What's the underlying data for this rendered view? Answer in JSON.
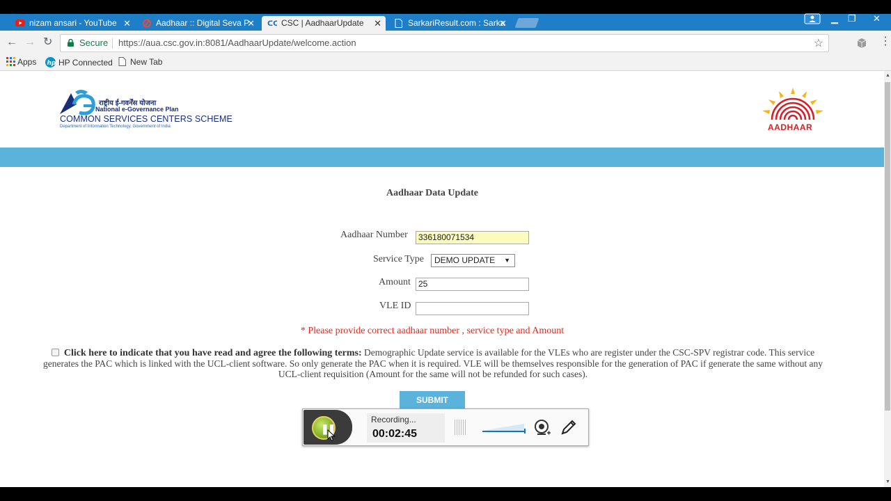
{
  "browser": {
    "tabs": [
      {
        "title": "nizam ansari - YouTube",
        "icon": "youtube-icon",
        "active": false
      },
      {
        "title": "Aadhaar :: Digital Seva P",
        "icon": "digital-seva-icon",
        "active": false
      },
      {
        "title": "CSC | AadhaarUpdate",
        "icon": "csc-favicon-icon",
        "active": true
      },
      {
        "title": "SarkariResult.com : Sarka",
        "icon": "page-icon",
        "active": false
      }
    ],
    "secure_label": "Secure",
    "url": "https://aua.csc.gov.in:8081/AadhaarUpdate/welcome.action",
    "bookmarks": [
      {
        "label": "Apps",
        "icon": "apps-grid-icon"
      },
      {
        "label": "HP Connected",
        "icon": "hp-icon"
      },
      {
        "label": "New Tab",
        "icon": "page-icon"
      }
    ],
    "colors": {
      "tabstrip": "#1f7ec8",
      "secure": "#0b8043"
    }
  },
  "header": {
    "csc_logo": {
      "hindi_line": "राष्ट्रीय ई-गवर्नेंस योजना",
      "plan_line": "National e-Governance Plan",
      "scheme_line": "COMMON SERVICES CENTERS SCHEME",
      "dept_line": "Department of Information Technology, Government of India"
    },
    "aadhaar_logo_text": "AADHAAR",
    "band_color": "#5bb3dc"
  },
  "form": {
    "heading": "Aadhaar Data Update",
    "aadhaar_number": {
      "label": "Aadhaar Number",
      "value": "336180071534"
    },
    "service_type": {
      "label": "Service Type",
      "selected": "DEMO UPDATE"
    },
    "amount": {
      "label": "Amount",
      "value": "25"
    },
    "vle_id": {
      "label": "VLE ID",
      "value": ""
    },
    "warning": "* Please provide correct aadhaar number , service type and Amount",
    "terms_bold": "Click here to indicate that you have read and agree the following terms:",
    "terms_text": "Demographic Update service is available for the VLEs who are register under the CSC-SPV registrar code. This service generates the PAC which is linked with the UCL-client software. So only generate the PAC when it is required. VLE will be themselves responsible for the generation of PAC if generate the same without any UCL-client requisition (Amount for the same will not be refunded for such cases).",
    "submit_label": "SUBMIT",
    "warning_color": "#e0281c"
  },
  "recorder": {
    "status": "Recording...",
    "elapsed": "00:02:45"
  }
}
